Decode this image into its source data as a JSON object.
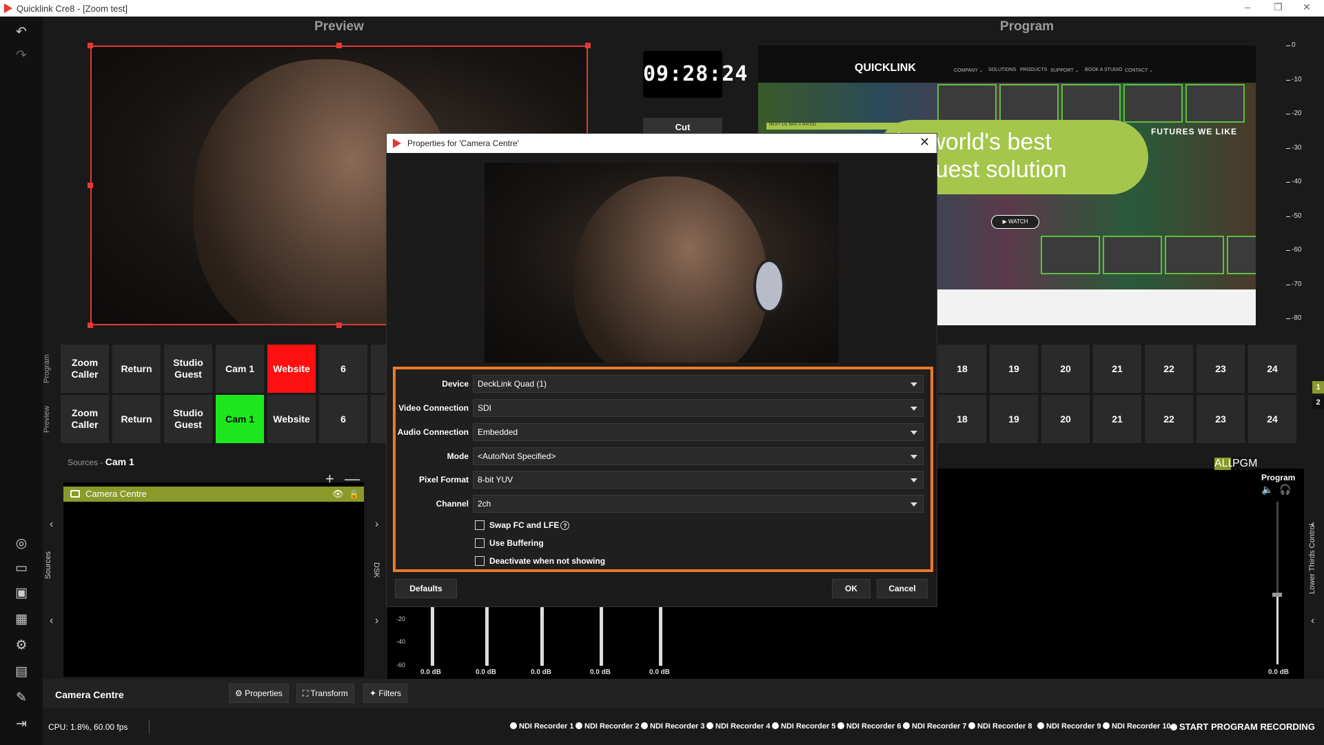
{
  "window": {
    "title": "Quicklink Cre8 - [Zoom test]"
  },
  "headers": {
    "preview": "Preview",
    "program": "Program"
  },
  "clock": "09:28:24",
  "cut_label": "Cut",
  "program_site": {
    "logo": "QUICKLINK",
    "nav": [
      "COMPANY ⌄",
      "SOLUTIONS",
      "PRODUCTS",
      "SUPPORT ⌄",
      "BOOK A STUDIO",
      "CONTACT ⌄"
    ],
    "banner": "he world's best\nte guest solution",
    "futures": "FUTURES WE LIKE",
    "next": "NEXT: LIL NAS X RATED",
    "watch": "▶ WATCH"
  },
  "vu_scale": [
    "0",
    "-10",
    "-20",
    "-30",
    "-40",
    "-50",
    "-60",
    "-70",
    "-80"
  ],
  "rows": {
    "program_label": "Program",
    "preview_label": "Preview",
    "program": [
      "Zoom\nCaller",
      "Return",
      "Studio\nGuest",
      "Cam 1",
      "Website",
      "6"
    ],
    "preview": [
      "Zoom\nCaller",
      "Return",
      "Studio\nGuest",
      "Cam 1",
      "Website",
      "6"
    ],
    "right": [
      "18",
      "19",
      "20",
      "21",
      "22",
      "23",
      "24"
    ],
    "badges": [
      "1",
      "2"
    ],
    "colors": {
      "program_active": "#ff1010",
      "preview_active": "#1ee61e"
    }
  },
  "sources": {
    "header_prefix": "Sources",
    "header_scene": "Cam 1",
    "vertical_label": "Sources",
    "items": [
      {
        "label": "Camera Centre"
      }
    ]
  },
  "dsk_label": "DSK",
  "mixer": {
    "all": "ALL",
    "pgm": "PGM",
    "program": "Program",
    "scale": [
      "-20",
      "-40",
      "-60"
    ],
    "db": [
      "0.0 dB",
      "0.0 dB",
      "0.0 dB",
      "0.0 dB",
      "0.0 dB",
      "0.0 dB"
    ],
    "lower_thirds": "Lower Thirds Control"
  },
  "toolbar": {
    "selected": "Camera Centre",
    "properties": "Properties",
    "transform": "Transform",
    "filters": "Filters"
  },
  "status": {
    "cpu": "CPU: 1.8%, 60.00 fps",
    "recorders": [
      "NDI Recorder 1",
      "NDI Recorder 2",
      "NDI Recorder 3",
      "NDI Recorder 4",
      "NDI Recorder 5",
      "NDI Recorder 6",
      "NDI Recorder 7",
      "NDI Recorder 8",
      "NDI Recorder 9",
      "NDI Recorder 10"
    ],
    "start": "START PROGRAM RECORDING"
  },
  "dialog": {
    "title": "Properties for 'Camera Centre'",
    "fields": [
      {
        "label": "Device",
        "value": "DeckLink Quad (1)"
      },
      {
        "label": "Video Connection",
        "value": "SDI"
      },
      {
        "label": "Audio Connection",
        "value": "Embedded"
      },
      {
        "label": "Mode",
        "value": "<Auto/Not Specified>"
      },
      {
        "label": "Pixel Format",
        "value": "8-bit YUV"
      },
      {
        "label": "Channel",
        "value": "2ch"
      }
    ],
    "checks": [
      "Swap FC and LFE",
      "Use Buffering",
      "Deactivate when not showing"
    ],
    "defaults": "Defaults",
    "ok": "OK",
    "cancel": "Cancel",
    "highlight_color": "#f0782a"
  }
}
